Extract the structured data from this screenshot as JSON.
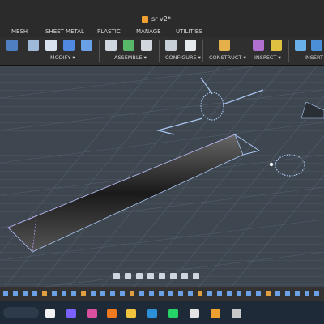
{
  "app": {
    "file_title": "sr v2*"
  },
  "tabs": [
    {
      "label": "MESH"
    },
    {
      "label": "SHEET METAL"
    },
    {
      "label": "PLASTIC"
    },
    {
      "label": "MANAGE"
    },
    {
      "label": "UTILITIES"
    }
  ],
  "toolbar_groups": [
    {
      "label": "MODIFY ▾"
    },
    {
      "label": "ASSEMBLE ▾"
    },
    {
      "label": "CONFIGURE ▾"
    },
    {
      "label": "CONSTRUCT ▾"
    },
    {
      "label": "INSPECT ▾"
    },
    {
      "label": "INSERT"
    }
  ],
  "colors": {
    "accent": "#f0a030",
    "canvas_bg": "#3e4650",
    "grid": "#56606b",
    "sketch": "#a9c7f2",
    "selection": "#6d8bd9"
  },
  "taskbar_icons": [
    "search-box",
    "start-icon",
    "copilot-icon",
    "game-icon",
    "firefox-icon",
    "folder-icon",
    "edge-icon",
    "whatsapp-icon",
    "chrome-icon",
    "fusion-icon",
    "settings-icon"
  ]
}
